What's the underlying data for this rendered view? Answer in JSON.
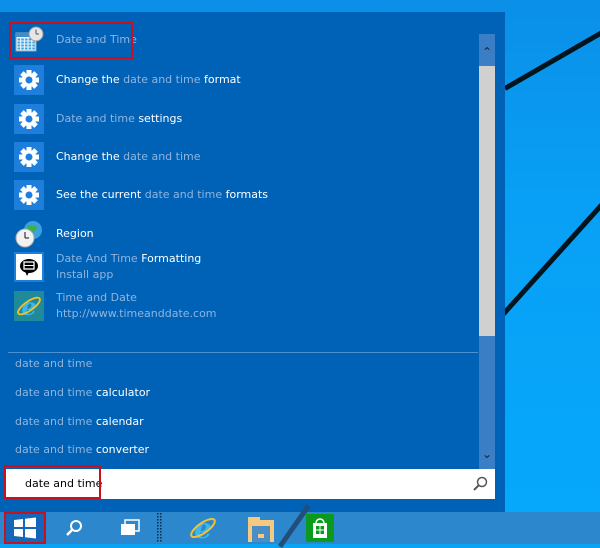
{
  "results": [
    {
      "icon": "calendar-clock-icon",
      "parts": [
        {
          "t": "Date and Time",
          "dim": true
        }
      ],
      "sub": null
    },
    {
      "icon": "gear-icon",
      "parts": [
        {
          "t": "Change the ",
          "dim": false
        },
        {
          "t": "date and time",
          "dim": true
        },
        {
          "t": " format",
          "dim": false
        }
      ],
      "sub": null
    },
    {
      "icon": "gear-icon",
      "parts": [
        {
          "t": "Date and time ",
          "dim": true
        },
        {
          "t": "settings",
          "dim": false
        }
      ],
      "sub": null
    },
    {
      "icon": "gear-icon",
      "parts": [
        {
          "t": "Change the ",
          "dim": false
        },
        {
          "t": "date and time",
          "dim": true
        }
      ],
      "sub": null
    },
    {
      "icon": "gear-icon",
      "parts": [
        {
          "t": "See the current ",
          "dim": false
        },
        {
          "t": "date and time",
          "dim": true
        },
        {
          "t": " formats",
          "dim": false
        }
      ],
      "sub": null
    },
    {
      "icon": "globe-clock-icon",
      "parts": [
        {
          "t": "Region",
          "dim": false
        }
      ],
      "sub": null
    },
    {
      "icon": "app-store-icon",
      "parts": [
        {
          "t": "Date And Time ",
          "dim": true
        },
        {
          "t": "Formatting",
          "dim": false
        }
      ],
      "sub": "Install app"
    },
    {
      "icon": "internet-explorer-icon",
      "parts": [
        {
          "t": "Time and Date",
          "dim": true
        }
      ],
      "sub": "http://www.timeanddate.com"
    }
  ],
  "suggestions": [
    {
      "dim": "date and time",
      "bold": ""
    },
    {
      "dim": "date and time ",
      "bold": "calculator"
    },
    {
      "dim": "date and time ",
      "bold": "calendar"
    },
    {
      "dim": "date and time ",
      "bold": "converter"
    }
  ],
  "search": {
    "value": "date and time"
  },
  "scroll": {
    "up": "⌃",
    "down": "⌄"
  },
  "taskbar": [
    "start-button",
    "search-button",
    "task-view-button",
    "internet-explorer",
    "file-explorer",
    "store"
  ]
}
